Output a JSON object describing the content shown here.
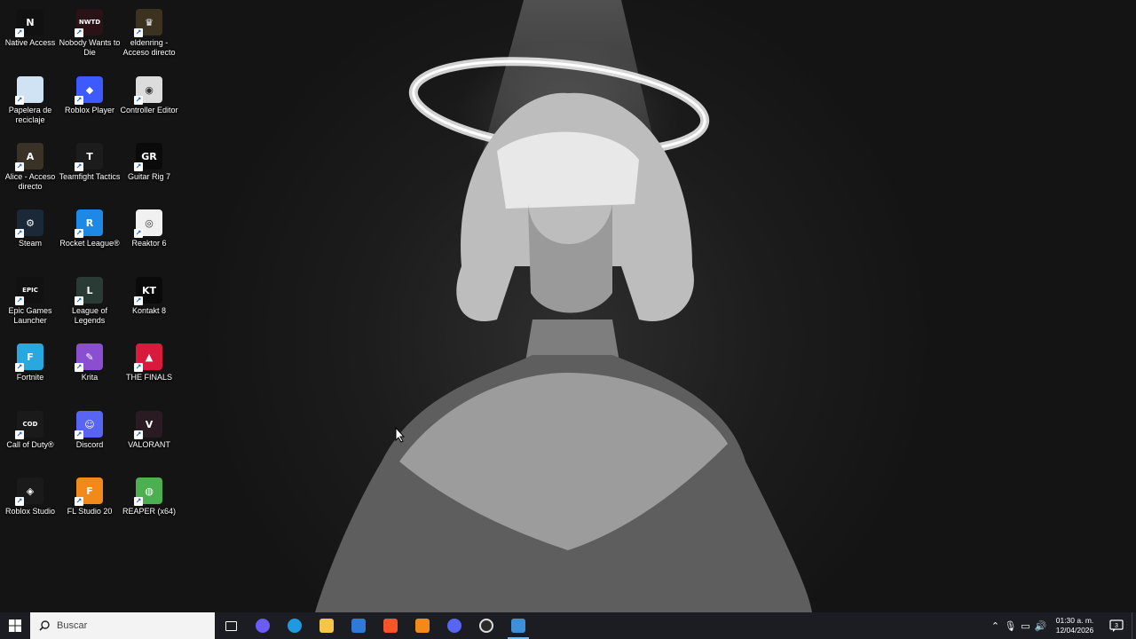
{
  "desktop": {
    "icons": [
      {
        "label": "Native Access",
        "icon": "native-access-icon",
        "color": "#111111",
        "glyph": "N"
      },
      {
        "label": "Nobody Wants to Die",
        "icon": "nobody-wants-to-die-icon",
        "color": "#2a1216",
        "glyph": "NWTD"
      },
      {
        "label": "eldenring - Acceso directo",
        "icon": "elden-ring-icon",
        "color": "#3b3320",
        "glyph": "♛"
      },
      {
        "label": "Papelera de reciclaje",
        "icon": "recycle-bin-icon",
        "color": "#cfe3f5",
        "glyph": ""
      },
      {
        "label": "Roblox Player",
        "icon": "roblox-player-icon",
        "color": "#3d5afe",
        "glyph": "◆"
      },
      {
        "label": "Controller Editor",
        "icon": "controller-editor-icon",
        "color": "#dcdcdc",
        "glyph": "◉"
      },
      {
        "label": "Alice - Acceso directo",
        "icon": "alice-icon",
        "color": "#3a3226",
        "glyph": "A"
      },
      {
        "label": "Teamfight Tactics",
        "icon": "teamfight-tactics-icon",
        "color": "#1c1c1c",
        "glyph": "T"
      },
      {
        "label": "Guitar Rig 7",
        "icon": "guitar-rig-icon",
        "color": "#0a0a0a",
        "glyph": "GR"
      },
      {
        "label": "Steam",
        "icon": "steam-icon",
        "color": "#1b2838",
        "glyph": "⚙"
      },
      {
        "label": "Rocket League®",
        "icon": "rocket-league-icon",
        "color": "#1e88e5",
        "glyph": "R"
      },
      {
        "label": "Reaktor 6",
        "icon": "reaktor-icon",
        "color": "#f0f0f0",
        "glyph": "◎"
      },
      {
        "label": "Epic Games Launcher",
        "icon": "epic-games-icon",
        "color": "#111111",
        "glyph": "EPIC"
      },
      {
        "label": "League of Legends",
        "icon": "league-of-legends-icon",
        "color": "#2a3b35",
        "glyph": "L"
      },
      {
        "label": "Kontakt 8",
        "icon": "kontakt-icon",
        "color": "#0a0a0a",
        "glyph": "KT"
      },
      {
        "label": "Fortnite",
        "icon": "fortnite-icon",
        "color": "#29a8e0",
        "glyph": "F"
      },
      {
        "label": "Krita",
        "icon": "krita-icon",
        "color": "#8a4fd0",
        "glyph": "✎"
      },
      {
        "label": "THE FINALS",
        "icon": "the-finals-icon",
        "color": "#d81b3c",
        "glyph": "▲"
      },
      {
        "label": "Call of Duty®",
        "icon": "call-of-duty-icon",
        "color": "#1a1a1a",
        "glyph": "COD"
      },
      {
        "label": "Discord",
        "icon": "discord-icon",
        "color": "#5865f2",
        "glyph": "☺"
      },
      {
        "label": "VALORANT",
        "icon": "valorant-icon",
        "color": "#2a1a22",
        "glyph": "V"
      },
      {
        "label": "Roblox Studio",
        "icon": "roblox-studio-icon",
        "color": "#1a1a1a",
        "glyph": "◈"
      },
      {
        "label": "FL Studio 20",
        "icon": "fl-studio-icon",
        "color": "#f28a1b",
        "glyph": "F"
      },
      {
        "label": "REAPER (x64)",
        "icon": "reaper-icon",
        "color": "#4caf50",
        "glyph": "◍"
      }
    ]
  },
  "taskbar": {
    "search_placeholder": "Buscar",
    "apps": [
      {
        "icon": "task-view-icon",
        "color": "#ffffff"
      },
      {
        "icon": "copilot-icon",
        "color": "#6a5cf5"
      },
      {
        "icon": "edge-icon",
        "color": "#1f9ae0"
      },
      {
        "icon": "file-explorer-icon",
        "color": "#f3c64a"
      },
      {
        "icon": "microsoft-store-icon",
        "color": "#2f7ad6"
      },
      {
        "icon": "brave-icon",
        "color": "#fb542b"
      },
      {
        "icon": "fl-studio-taskbar-icon",
        "color": "#f28a1b"
      },
      {
        "icon": "discord-taskbar-icon",
        "color": "#5865f2"
      },
      {
        "icon": "obs-icon",
        "color": "#2b2b2b"
      },
      {
        "icon": "app-active-icon",
        "color": "#3f8fd8"
      }
    ],
    "clock": {
      "time": "01:30 a. m.",
      "date": "12/04/2026"
    },
    "notification_count": "3"
  }
}
